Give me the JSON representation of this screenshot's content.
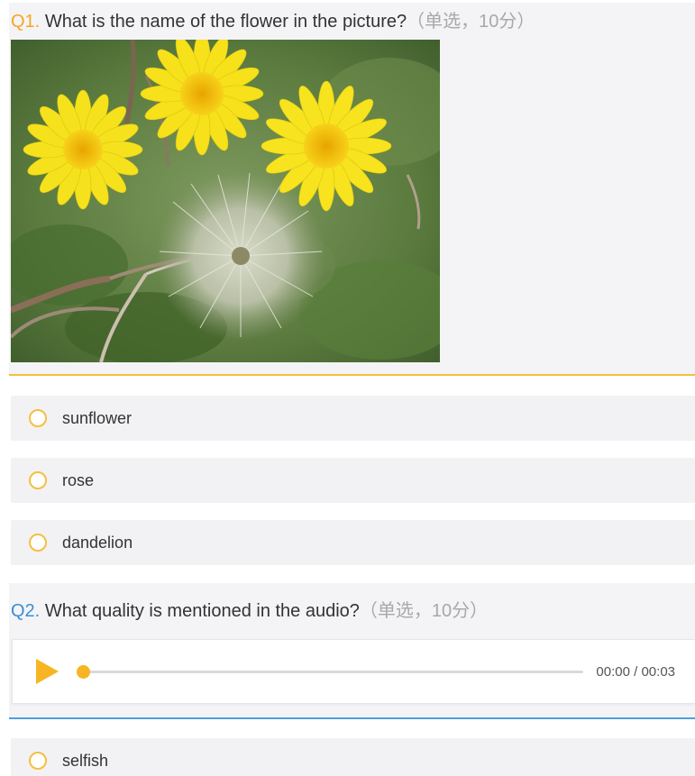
{
  "colors": {
    "q1_accent": "#f5a623",
    "q2_accent": "#3a8fd6",
    "radio_border": "#f5bf3f",
    "play": "#f7b523"
  },
  "questions": [
    {
      "number": "Q1.",
      "text": "What is the name of the flower in the picture?",
      "meta": "（单选，10分）",
      "media": "image",
      "image_alt_icon": "flower-image",
      "options": [
        "sunflower",
        "rose",
        "dandelion"
      ]
    },
    {
      "number": "Q2.",
      "text": "What quality is mentioned in the audio?",
      "meta": "（单选，10分）",
      "media": "audio",
      "audio": {
        "time": "00:00 / 00:03",
        "progress": 0,
        "play_icon": "play-icon"
      },
      "options": [
        "selfish"
      ]
    }
  ]
}
